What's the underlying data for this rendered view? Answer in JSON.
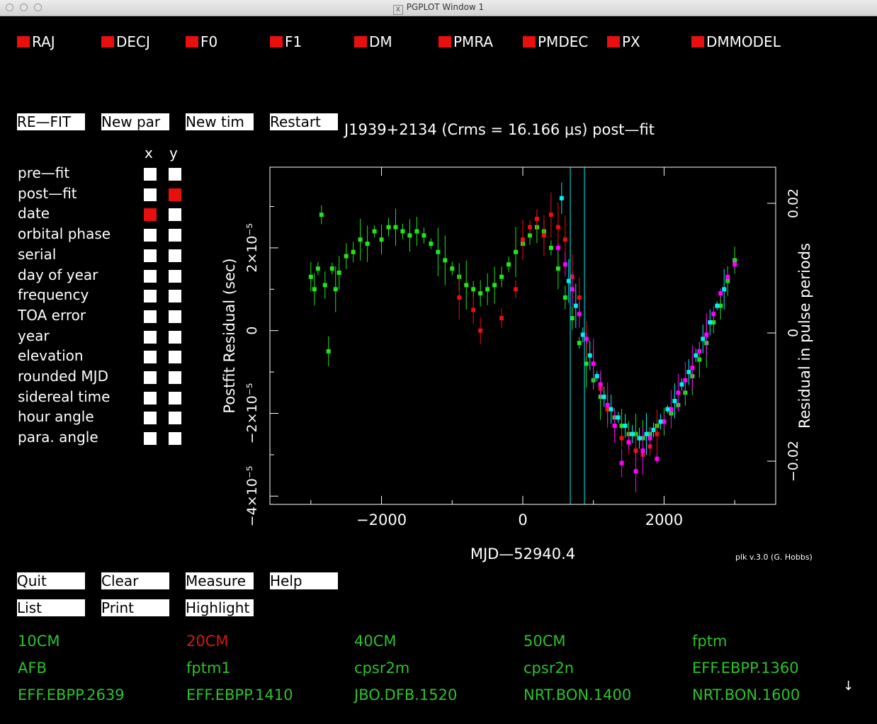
{
  "window": {
    "title": "PGPLOT Window 1"
  },
  "params": [
    "RAJ",
    "DECJ",
    "F0",
    "F1",
    "DM",
    "PMRA",
    "PMDEC",
    "PX",
    "DMMODEL"
  ],
  "top_buttons": {
    "refit": "RE—FIT",
    "new_par": "New par",
    "new_tim": "New tim",
    "restart": "Restart"
  },
  "axis_header": {
    "x": "x",
    "y": "y"
  },
  "axis_options": [
    {
      "label": "pre—fit",
      "x": false,
      "y": false
    },
    {
      "label": "post—fit",
      "x": false,
      "y": true
    },
    {
      "label": "date",
      "x": true,
      "y": false
    },
    {
      "label": "orbital phase",
      "x": false,
      "y": false
    },
    {
      "label": "serial",
      "x": false,
      "y": false
    },
    {
      "label": "day of year",
      "x": false,
      "y": false
    },
    {
      "label": "frequency",
      "x": false,
      "y": false
    },
    {
      "label": "TOA error",
      "x": false,
      "y": false
    },
    {
      "label": "year",
      "x": false,
      "y": false
    },
    {
      "label": "elevation",
      "x": false,
      "y": false
    },
    {
      "label": "rounded MJD",
      "x": false,
      "y": false
    },
    {
      "label": "sidereal time",
      "x": false,
      "y": false
    },
    {
      "label": "hour angle",
      "x": false,
      "y": false
    },
    {
      "label": "para. angle",
      "x": false,
      "y": false
    }
  ],
  "bottom_buttons": {
    "quit": "Quit",
    "clear": "Clear",
    "measure": "Measure",
    "help": "Help",
    "list": "List",
    "print": "Print",
    "highlight": "Highlight"
  },
  "flags": [
    {
      "label": "10CM",
      "color": "#2ec12e"
    },
    {
      "label": "20CM",
      "color": "#d11a13"
    },
    {
      "label": "40CM",
      "color": "#2ec12e"
    },
    {
      "label": "50CM",
      "color": "#2ec12e"
    },
    {
      "label": "fptm",
      "color": "#2ec12e"
    },
    {
      "label": "AFB",
      "color": "#2ec12e"
    },
    {
      "label": "fptm1",
      "color": "#2ec12e"
    },
    {
      "label": "cpsr2m",
      "color": "#2ec12e"
    },
    {
      "label": "cpsr2n",
      "color": "#2ec12e"
    },
    {
      "label": "EFF.EBPP.1360",
      "color": "#2ec12e"
    },
    {
      "label": "EFF.EBPP.2639",
      "color": "#2ec12e"
    },
    {
      "label": "EFF.EBPP.1410",
      "color": "#2ec12e"
    },
    {
      "label": "JBO.DFB.1520",
      "color": "#2ec12e"
    },
    {
      "label": "NRT.BON.1400",
      "color": "#2ec12e"
    },
    {
      "label": "NRT.BON.1600",
      "color": "#2ec12e"
    }
  ],
  "scroll_arrow": "↓",
  "credit": "plk v.3.0 (G. Hobbs)",
  "chart_data": {
    "type": "scatter",
    "title": "J1939+2134 (Crms = 16.166 μs) post—fit",
    "xlabel": "MJD—52940.4",
    "ylabel": "Postfit Residual (sec)",
    "y2label": "Residual in pulse periods",
    "xlim": [
      -3580,
      3580
    ],
    "ylim": [
      -4.2e-05,
      3.95e-05
    ],
    "x_ticks": [
      "−2000",
      "0",
      "2000"
    ],
    "y_ticks": [
      "−4×10⁻⁵",
      "−2×10⁻⁵",
      "0",
      "2×10⁻⁵"
    ],
    "y2_ticks": [
      "−0.02",
      "0",
      "0.02"
    ],
    "colors": {
      "green": "#22e31e",
      "red": "#e8100f",
      "magenta": "#ff00ff",
      "cyan": "#00f0f0"
    },
    "series": [
      {
        "color": "green",
        "x": [
          -3000,
          -2950,
          -2900,
          -2850,
          -2800,
          -2750,
          -2700,
          -2650,
          -2600,
          -2500,
          -2400,
          -2300,
          -2200,
          -2100,
          -2000,
          -1900,
          -1800,
          -1700,
          -1600,
          -1500,
          -1400,
          -1300,
          -1200,
          -1100,
          -1000,
          -900,
          -800,
          -700,
          -600,
          -500,
          -400,
          -300,
          -200,
          -100,
          0,
          100,
          200,
          300,
          400,
          500,
          600,
          700,
          800,
          900,
          1000,
          1100,
          1200,
          1300,
          1400,
          1500,
          1600,
          1700,
          1800,
          1900,
          2000,
          2100,
          2200,
          2300,
          2400,
          2500,
          2600,
          2700,
          2800,
          2900,
          3000
        ],
        "y": [
          1.3e-05,
          1e-05,
          1.5e-05,
          2.8e-05,
          1.1e-05,
          -5e-06,
          1.5e-05,
          1e-05,
          1.4e-05,
          1.8e-05,
          1.9e-05,
          2.2e-05,
          2.1e-05,
          2.4e-05,
          2.2e-05,
          2.5e-05,
          2.5e-05,
          2.4e-05,
          2.3e-05,
          2.4e-05,
          2.3e-05,
          2.1e-05,
          1.9e-05,
          1.7e-05,
          1.5e-05,
          1.3e-05,
          1.1e-05,
          1e-05,
          9e-06,
          1e-05,
          1.1e-05,
          1.3e-05,
          1.6e-05,
          1.9e-05,
          2.1e-05,
          2.3e-05,
          2.5e-05,
          2.4e-05,
          2e-05,
          1.5e-05,
          8e-06,
          3e-06,
          -3e-06,
          -8e-06,
          -1.2e-05,
          -1.6e-05,
          -1.9e-05,
          -2.1e-05,
          -2.3e-05,
          -2.5e-05,
          -2.5e-05,
          -2.6e-05,
          -2.5e-05,
          -2.3e-05,
          -2.2e-05,
          -2e-05,
          -1.8e-05,
          -1.5e-05,
          -1.1e-05,
          -7e-06,
          -3e-06,
          2e-06,
          6e-06,
          1.2e-05,
          1.7e-05
        ]
      },
      {
        "color": "red",
        "x": [
          -900,
          -700,
          -600,
          -300,
          -100,
          0,
          100,
          200,
          300,
          400,
          500,
          600,
          700,
          800,
          900,
          1000,
          1100,
          1200,
          1300,
          1400,
          1500,
          1600,
          1700,
          1800,
          1900
        ],
        "y": [
          8e-06,
          5e-06,
          0.0,
          3e-06,
          1e-05,
          2.2e-05,
          2.5e-05,
          2.7e-05,
          2.3e-05,
          2.8e-05,
          2.5e-05,
          2.2e-05,
          1.3e-05,
          8e-06,
          -2e-06,
          -8e-06,
          -1.4e-05,
          -1.9e-05,
          -2.3e-05,
          -2.6e-05,
          -2.7e-05,
          -2.9e-05,
          -3e-05,
          -2.8e-05,
          -2.5e-05
        ]
      },
      {
        "color": "magenta",
        "x": [
          500,
          600,
          700,
          800,
          900,
          1000,
          1100,
          1200,
          1300,
          1400,
          1500,
          1600,
          1700,
          1800,
          1900,
          2000,
          2100,
          2200,
          2300,
          2400,
          2500,
          2600,
          2700,
          2800,
          2900,
          3000
        ],
        "y": [
          2e-05,
          1.6e-05,
          1e-05,
          4e-06,
          -2e-06,
          -8e-06,
          -1.3e-05,
          -1.8e-05,
          -2.3e-05,
          -3.2e-05,
          -2.7e-05,
          -3.4e-05,
          -2.9e-05,
          -2.6e-05,
          -3.1e-05,
          -2.2e-05,
          -1.9e-05,
          -1.5e-05,
          -1.2e-05,
          -9e-06,
          -5e-06,
          -1e-06,
          4e-06,
          9e-06,
          1.3e-05,
          1.6e-05
        ]
      },
      {
        "color": "cyan",
        "x": [
          550,
          650,
          750,
          850,
          950,
          1050,
          1150,
          1250,
          1350,
          1450,
          1550,
          1650,
          1750,
          1850,
          1950,
          2050,
          2150,
          2250,
          2350,
          2450,
          2550,
          2650,
          2750,
          2850
        ],
        "y": [
          3.2e-05,
          1.2e-05,
          6e-06,
          -1e-06,
          -6e-06,
          -1.1e-05,
          -1.6e-05,
          -1.9e-05,
          -2.1e-05,
          -2.3e-05,
          -2.5e-05,
          -2.6e-05,
          -2.5e-05,
          -2.4e-05,
          -2.2e-05,
          -1.9e-05,
          -1.7e-05,
          -1.3e-05,
          -1e-05,
          -6e-06,
          -2e-06,
          2e-06,
          6e-06,
          1e-05
        ]
      }
    ]
  }
}
